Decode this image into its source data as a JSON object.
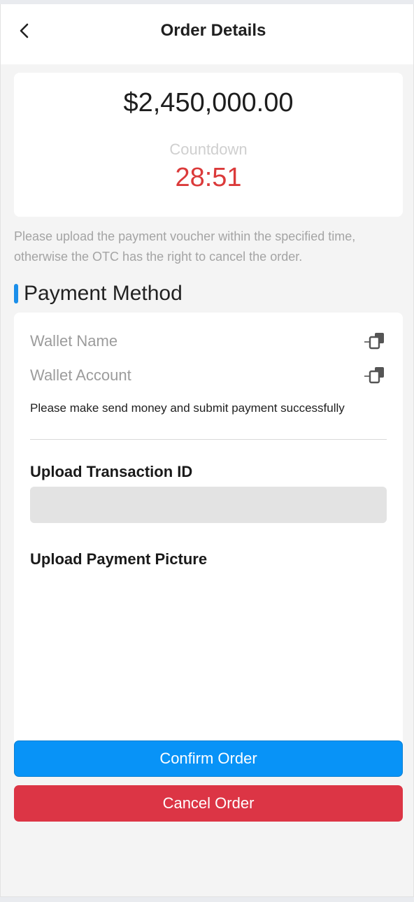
{
  "header": {
    "title": "Order Details",
    "back_icon": "chevron-left-icon"
  },
  "order": {
    "amount": "$2,450,000.00",
    "countdown_label": "Countdown",
    "countdown_value": "28:51",
    "countdown_color": "#db3a3a"
  },
  "notice": "Please upload the payment voucher within the specified time, otherwise the OTC has the right to cancel the order.",
  "payment": {
    "section_title": "Payment Method",
    "accent_color": "#1b8fea",
    "wallet_name_label": "Wallet Name",
    "wallet_account_label": "Wallet Account",
    "copy_icon": "copy-icon",
    "instruction": "Please make send money and submit payment successfully",
    "transaction_label": "Upload Transaction ID",
    "transaction_value": "",
    "picture_label": "Upload Payment Picture"
  },
  "actions": {
    "confirm_label": "Confirm Order",
    "confirm_color": "#0893f7",
    "cancel_label": "Cancel Order",
    "cancel_color": "#dc3545"
  }
}
